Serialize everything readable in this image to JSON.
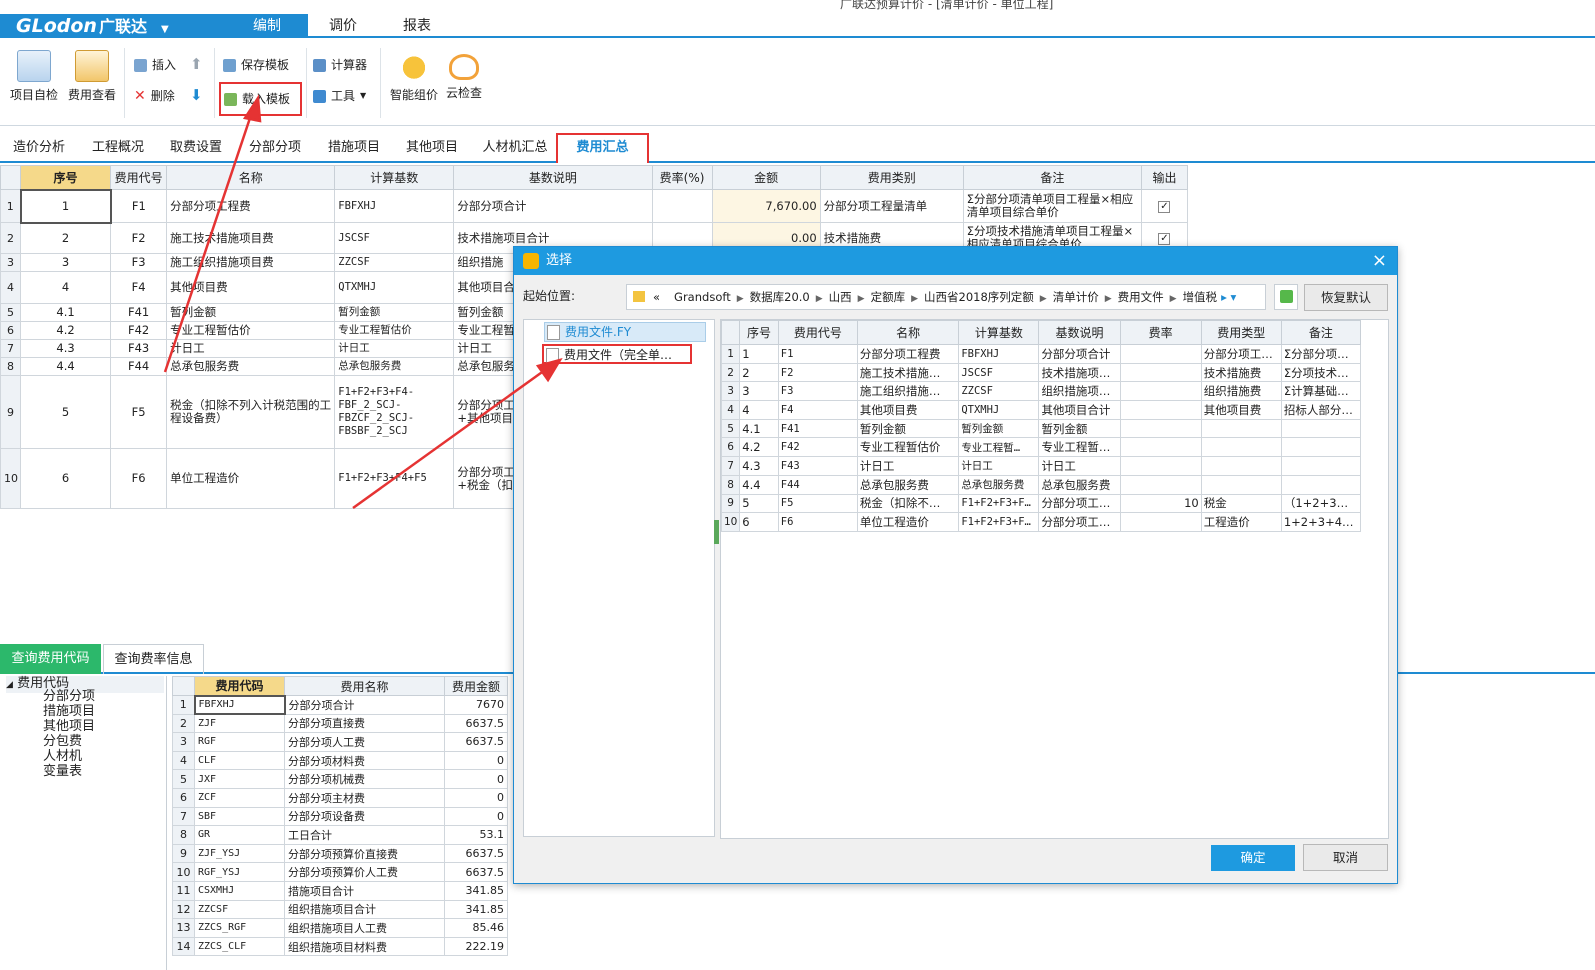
{
  "window": {
    "title": "广联达预算计价 - [清单计价 - 单位工程]"
  },
  "app": {
    "logo_en": "GLodon",
    "logo_cn": "广联达",
    "logo_dropdown": "▼"
  },
  "menu": {
    "items": [
      "编制",
      "调价",
      "报表"
    ]
  },
  "ribbon": {
    "project_check": "项目自检",
    "fee_view": "费用查看",
    "insert": "插入",
    "delete": "删除",
    "save_template": "保存模板",
    "load_template": "载入模板",
    "calculator": "计算器",
    "tools": "工具",
    "smart_price": "智能组价",
    "cloud_check": "云检查"
  },
  "tabs": [
    "造价分析",
    "工程概况",
    "取费设置",
    "分部分项",
    "措施项目",
    "其他项目",
    "人材机汇总",
    "费用汇总"
  ],
  "main_table": {
    "headers": [
      "序号",
      "费用代号",
      "名称",
      "计算基数",
      "基数说明",
      "费率(%)",
      "金额",
      "费用类别",
      "备注",
      "输出"
    ],
    "rows": [
      {
        "rn": "1",
        "seq": "1",
        "code": "F1",
        "name": "分部分项工程费",
        "base": "FBFXHJ",
        "desc": "分部分项合计",
        "rate": "",
        "amount": "7,670.00",
        "category": "分部分项工程量清单",
        "note": "Σ分部分项清单项目工程量×相应清单项目综合单价",
        "output": "✓"
      },
      {
        "rn": "2",
        "seq": "2",
        "code": "F2",
        "name": "施工技术措施项目费",
        "base": "JSCSF",
        "desc": "技术措施项目合计",
        "rate": "",
        "amount": "0.00",
        "category": "技术措施费",
        "note": "Σ分项技术措施清单项目工程量×相应清单项目综合单价",
        "output": "✓"
      },
      {
        "rn": "3",
        "seq": "3",
        "code": "F3",
        "name": "施工组织措施项目费",
        "base": "ZZCSF",
        "desc": "组织措施",
        "rate": "",
        "amount": "",
        "category": "",
        "note": "",
        "output": ""
      },
      {
        "rn": "4",
        "seq": "4",
        "code": "F4",
        "name": "其他项目费",
        "base": "QTXMHJ",
        "desc": "其他项目合",
        "rate": "",
        "amount": "",
        "category": "",
        "note": "",
        "output": ""
      },
      {
        "rn": "5",
        "seq": "4.1",
        "code": "F41",
        "name": "暂列金额",
        "base": "暂列金额",
        "desc": "暂列金额",
        "rate": "",
        "amount": "",
        "category": "",
        "note": "",
        "output": ""
      },
      {
        "rn": "6",
        "seq": "4.2",
        "code": "F42",
        "name": "专业工程暂估价",
        "base": "专业工程暂估价",
        "desc": "专业工程暂",
        "rate": "",
        "amount": "",
        "category": "",
        "note": "",
        "output": ""
      },
      {
        "rn": "7",
        "seq": "4.3",
        "code": "F43",
        "name": "计日工",
        "base": "计日工",
        "desc": "计日工",
        "rate": "",
        "amount": "",
        "category": "",
        "note": "",
        "output": ""
      },
      {
        "rn": "8",
        "seq": "4.4",
        "code": "F44",
        "name": "总承包服务费",
        "base": "总承包服务费",
        "desc": "总承包服务",
        "rate": "",
        "amount": "",
        "category": "",
        "note": "",
        "output": ""
      },
      {
        "rn": "9",
        "seq": "5",
        "code": "F5",
        "name": "税金（扣除不列入计税范围的工程设备费）",
        "base": "F1+F2+F3+F4-FBF_2_SCJ-FBZCF_2_SCJ-FBSBF_2_SCJ",
        "desc": "分部分项工程费+施工组织措施费+其他项目费-扣除工程市场价主材费",
        "rate": "",
        "amount": "",
        "category": "",
        "note": "",
        "output": ""
      },
      {
        "rn": "10",
        "seq": "6",
        "code": "F6",
        "name": "单位工程造价",
        "base": "F1+F2+F3+F4+F5",
        "desc": "分部分项工程费+施工组织措施费+税金（扣除设备费）",
        "rate": "",
        "amount": "",
        "category": "",
        "note": "",
        "output": ""
      }
    ]
  },
  "bottom": {
    "tabs": [
      "查询费用代码",
      "查询费率信息"
    ],
    "tree": {
      "root": "费用代码",
      "children": [
        "分部分项",
        "措施项目",
        "其他项目",
        "分包费",
        "人材机",
        "变量表"
      ]
    },
    "code_table": {
      "headers": [
        "费用代码",
        "费用名称",
        "费用金额"
      ],
      "rows": [
        [
          "1",
          "FBFXHJ",
          "分部分项合计",
          "7670"
        ],
        [
          "2",
          "ZJF",
          "分部分项直接费",
          "6637.5"
        ],
        [
          "3",
          "RGF",
          "分部分项人工费",
          "6637.5"
        ],
        [
          "4",
          "CLF",
          "分部分项材料费",
          "0"
        ],
        [
          "5",
          "JXF",
          "分部分项机械费",
          "0"
        ],
        [
          "6",
          "ZCF",
          "分部分项主材费",
          "0"
        ],
        [
          "7",
          "SBF",
          "分部分项设备费",
          "0"
        ],
        [
          "8",
          "GR",
          "工日合计",
          "53.1"
        ],
        [
          "9",
          "ZJF_YSJ",
          "分部分项预算价直接费",
          "6637.5"
        ],
        [
          "10",
          "RGF_YSJ",
          "分部分项预算价人工费",
          "6637.5"
        ],
        [
          "11",
          "CSXMHJ",
          "措施项目合计",
          "341.85"
        ],
        [
          "12",
          "ZZCSF",
          "组织措施项目合计",
          "341.85"
        ],
        [
          "13",
          "ZZCS_RGF",
          "组织措施项目人工费",
          "85.46"
        ],
        [
          "14",
          "ZZCS_CLF",
          "组织措施项目材料费",
          "222.19"
        ]
      ]
    }
  },
  "dialog": {
    "title": "选择",
    "close": "×",
    "start_label": "起始位置:",
    "path": [
      "«",
      "Grandsoft",
      "数据库20.0",
      "山西",
      "定额库",
      "山西省2018序列定额",
      "清单计价",
      "费用文件",
      "增值税"
    ],
    "path_more": "▸ ▾",
    "reset_button": "恢复默认",
    "files": [
      "费用文件.FY",
      "费用文件（完全单…"
    ],
    "grid": {
      "headers": [
        "序号",
        "费用代号",
        "名称",
        "计算基数",
        "基数说明",
        "费率",
        "费用类型",
        "备注"
      ],
      "rows": [
        [
          "1",
          "1",
          "F1",
          "分部分项工程费",
          "FBFXHJ",
          "分部分项合计",
          "",
          "分部分项工…",
          "Σ分部分项…"
        ],
        [
          "2",
          "2",
          "F2",
          "施工技术措施…",
          "JSCSF",
          "技术措施项…",
          "",
          "技术措施费",
          "Σ分项技术…"
        ],
        [
          "3",
          "3",
          "F3",
          "施工组织措施…",
          "ZZCSF",
          "组织措施项…",
          "",
          "组织措施费",
          "Σ计算基础…"
        ],
        [
          "4",
          "4",
          "F4",
          "其他项目费",
          "QTXMHJ",
          "其他项目合计",
          "",
          "其他项目费",
          "招标人部分…"
        ],
        [
          "5",
          "4.1",
          "F41",
          "暂列金额",
          "暂列金额",
          "暂列金额",
          "",
          "",
          ""
        ],
        [
          "6",
          "4.2",
          "F42",
          "专业工程暂估价",
          "专业工程暂…",
          "专业工程暂…",
          "",
          "",
          ""
        ],
        [
          "7",
          "4.3",
          "F43",
          "计日工",
          "计日工",
          "计日工",
          "",
          "",
          ""
        ],
        [
          "8",
          "4.4",
          "F44",
          "总承包服务费",
          "总承包服务费",
          "总承包服务费",
          "",
          "",
          ""
        ],
        [
          "9",
          "5",
          "F5",
          "税金（扣除不…",
          "F1+F2+F3+F…",
          "分部分项工…",
          "10",
          "税金",
          "（1+2+3…"
        ],
        [
          "10",
          "6",
          "F6",
          "单位工程造价",
          "F1+F2+F3+F…",
          "分部分项工…",
          "",
          "工程造价",
          "1+2+3+4…"
        ]
      ]
    },
    "ok": "确定",
    "cancel": "取消"
  },
  "colors": {
    "accent": "#1e8bd2",
    "highlight": "#e53333",
    "green": "#2cb86b"
  }
}
